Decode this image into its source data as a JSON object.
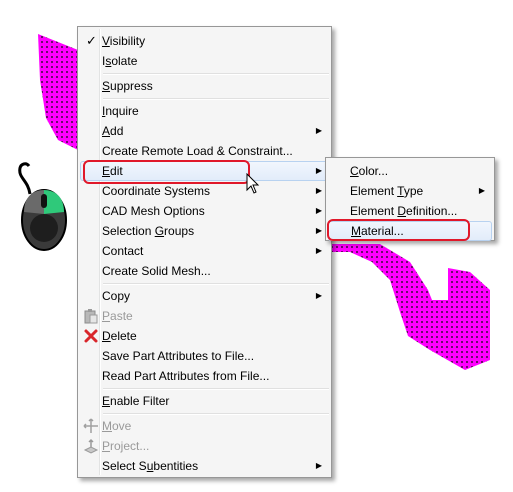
{
  "colors": {
    "mesh": "#ff00ff",
    "callout": "#e0182a",
    "hover": "#dbe8fa"
  },
  "menu": {
    "items": [
      {
        "label_pre": "",
        "mnemonic": "V",
        "label_post": "isibility",
        "checked": true
      },
      {
        "label_pre": "I",
        "mnemonic": "s",
        "label_post": "olate"
      },
      {
        "label_pre": "",
        "mnemonic": "S",
        "label_post": "uppress"
      },
      {
        "label_pre": "",
        "mnemonic": "I",
        "label_post": "nquire"
      },
      {
        "label_pre": "",
        "mnemonic": "A",
        "label_post": "dd",
        "submenu": true
      },
      {
        "label": "Create Remote Load & Constraint..."
      },
      {
        "label_pre": "",
        "mnemonic": "E",
        "label_post": "dit",
        "submenu": true,
        "highlighted": true
      },
      {
        "label": "Coordinate Systems",
        "submenu": true
      },
      {
        "label": "CAD Mesh Options",
        "submenu": true
      },
      {
        "label_pre": "Selection ",
        "mnemonic": "G",
        "label_post": "roups",
        "submenu": true
      },
      {
        "label": "Contact",
        "submenu": true
      },
      {
        "label": "Create Solid Mesh..."
      },
      {
        "label": "Copy",
        "submenu": true
      },
      {
        "label_pre": "",
        "mnemonic": "P",
        "label_post": "aste",
        "disabled": true,
        "icon": "paste-icon"
      },
      {
        "label_pre": "",
        "mnemonic": "D",
        "label_post": "elete",
        "icon": "delete-icon"
      },
      {
        "label": "Save Part Attributes to File..."
      },
      {
        "label": "Read Part Attributes from File..."
      },
      {
        "label_pre": "",
        "mnemonic": "E",
        "label_post": "nable Filter"
      },
      {
        "label_pre": "",
        "mnemonic": "M",
        "label_post": "ove",
        "disabled": true,
        "icon": "move-icon"
      },
      {
        "label_pre": "",
        "mnemonic": "P",
        "label_post": "roject...",
        "disabled": true,
        "icon": "project-icon"
      },
      {
        "label_pre": "Select S",
        "mnemonic": "u",
        "label_post": "bentities",
        "submenu": true
      }
    ]
  },
  "submenu": {
    "items": [
      {
        "label_pre": "",
        "mnemonic": "C",
        "label_post": "olor..."
      },
      {
        "label_pre": "Element ",
        "mnemonic": "T",
        "label_post": "ype",
        "submenu": true
      },
      {
        "label_pre": "Element ",
        "mnemonic": "D",
        "label_post": "efinition..."
      },
      {
        "label_pre": "",
        "mnemonic": "M",
        "label_post": "aterial...",
        "highlighted": true
      }
    ]
  },
  "icons": {
    "check": "✓",
    "arrow": "▶"
  }
}
